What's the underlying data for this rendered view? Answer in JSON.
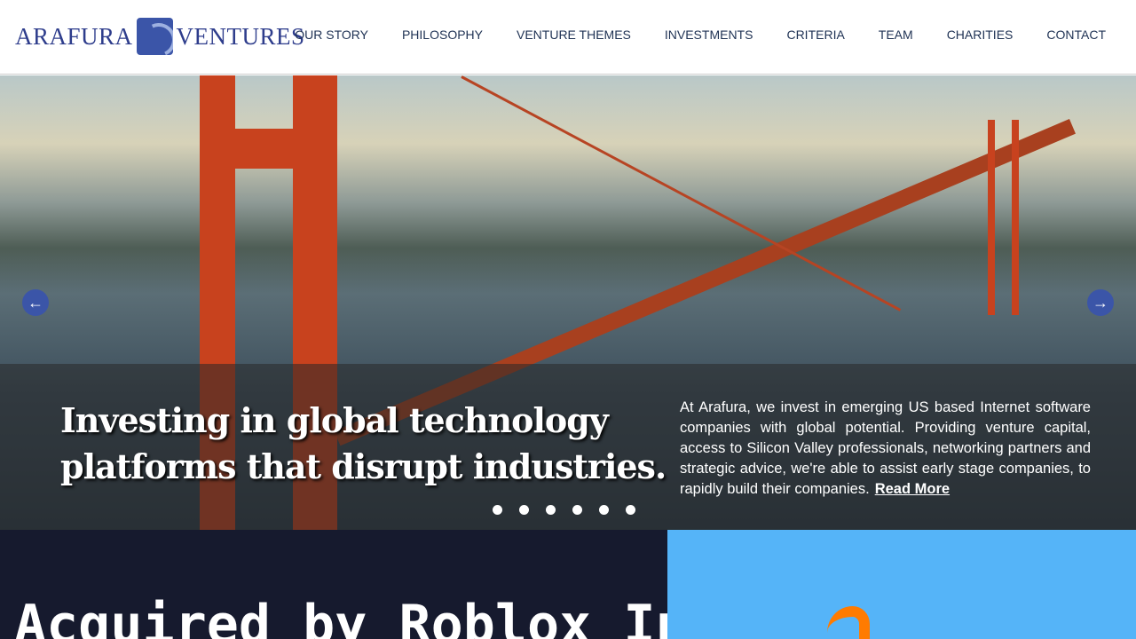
{
  "brand": {
    "left": "ARAFURA",
    "right": "VENTURES"
  },
  "nav": [
    "OUR STORY",
    "PHILOSOPHY",
    "VENTURE THEMES",
    "INVESTMENTS",
    "CRITERIA",
    "TEAM",
    "CHARITIES",
    "CONTACT"
  ],
  "hero": {
    "headline_line1": "Investing in global technology",
    "headline_line2": "platforms that disrupt industries.",
    "description": "At Arafura, we invest in emerging US based Internet software companies with global potential. Providing venture capital, access to Silicon Valley professionals, networking partners and strategic advice, we're able to assist early stage companies, to rapidly build their companies.",
    "read_more": "Read More",
    "prev": "←",
    "next": "→",
    "slide_count": 6
  },
  "panels": {
    "left_title": "Acquired by Roblox Inc."
  },
  "colors": {
    "brand": "#2e3d8c",
    "left_panel": "#161a2e",
    "right_panel": "#55b4f8",
    "accent": "#ff7b00"
  }
}
